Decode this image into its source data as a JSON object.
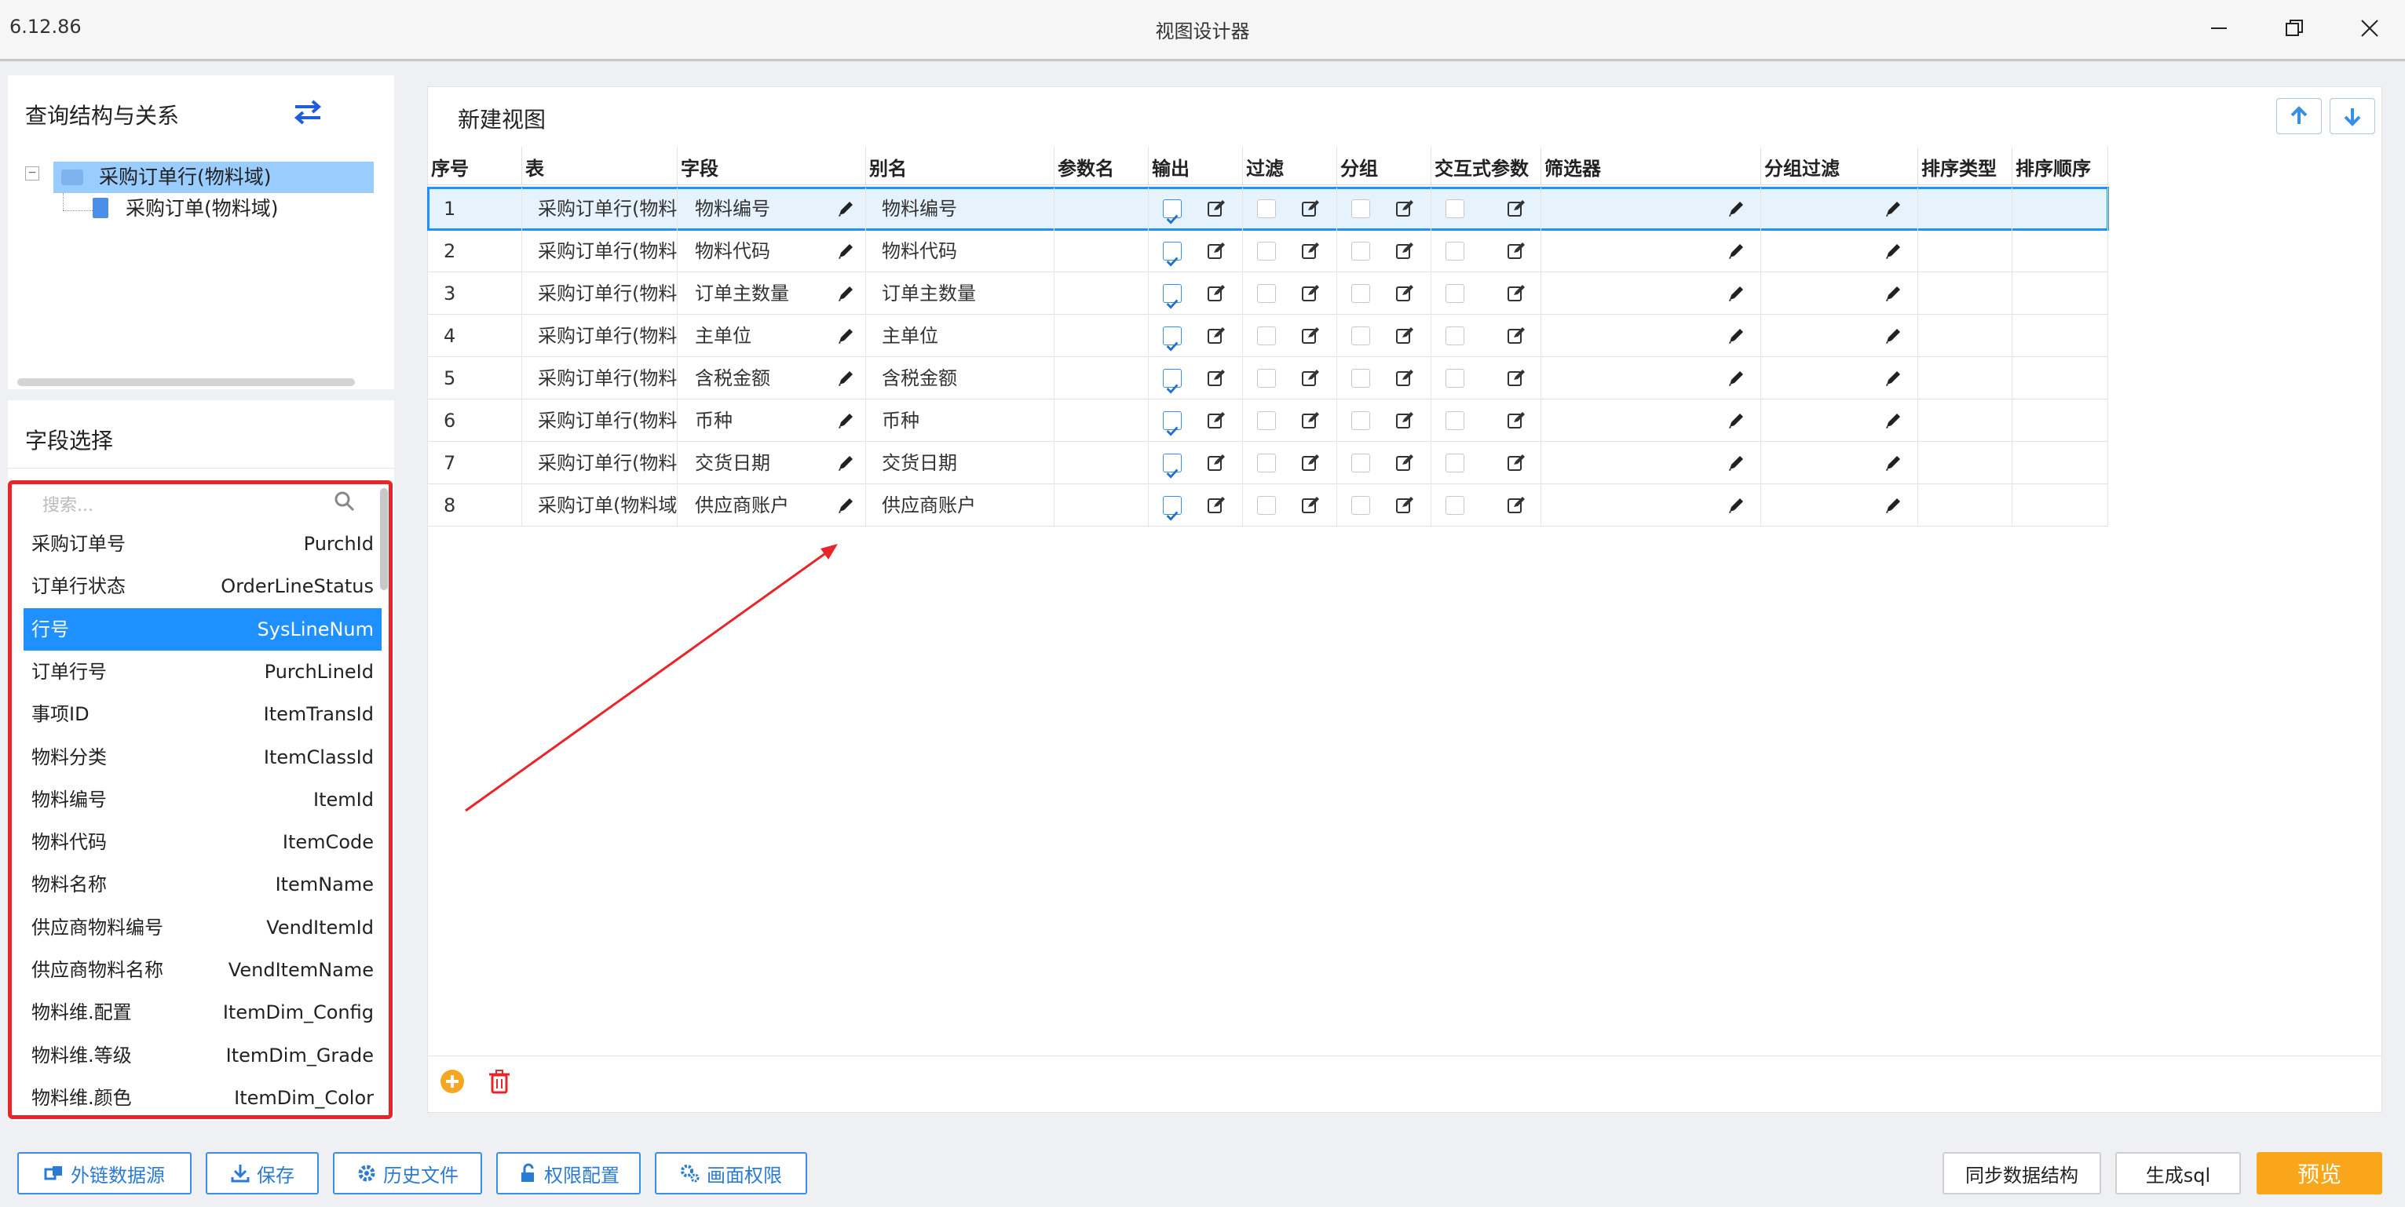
{
  "window": {
    "version": "6.12.86",
    "title": "视图设计器"
  },
  "query_panel": {
    "title": "查询结构与关系",
    "tree": [
      {
        "label": "采购订单行(物料域)",
        "selected": true
      },
      {
        "label": "采购订单(物料域)",
        "selected": false
      }
    ]
  },
  "field_panel": {
    "title": "字段选择",
    "search_placeholder": "搜索...",
    "fields": [
      {
        "cn": "采购订单号",
        "en": "PurchId"
      },
      {
        "cn": "订单行状态",
        "en": "OrderLineStatus"
      },
      {
        "cn": "行号",
        "en": "SysLineNum",
        "selected": true
      },
      {
        "cn": "订单行号",
        "en": "PurchLineId"
      },
      {
        "cn": "事项ID",
        "en": "ItemTransId"
      },
      {
        "cn": "物料分类",
        "en": "ItemClassId"
      },
      {
        "cn": "物料编号",
        "en": "ItemId"
      },
      {
        "cn": "物料代码",
        "en": "ItemCode"
      },
      {
        "cn": "物料名称",
        "en": "ItemName"
      },
      {
        "cn": "供应商物料编号",
        "en": "VendItemId"
      },
      {
        "cn": "供应商物料名称",
        "en": "VendItemName"
      },
      {
        "cn": "物料维.配置",
        "en": "ItemDim_Config"
      },
      {
        "cn": "物料维.等级",
        "en": "ItemDim_Grade"
      },
      {
        "cn": "物料维.颜色",
        "en": "ItemDim_Color"
      }
    ]
  },
  "view_panel": {
    "title": "新建视图",
    "columns": [
      "序号",
      "表",
      "字段",
      "别名",
      "参数名",
      "输出",
      "过滤",
      "分组",
      "交互式参数",
      "筛选器",
      "分组过滤",
      "排序类型",
      "排序顺序"
    ],
    "rows": [
      {
        "no": "1",
        "table": "采购订单行(物料域)",
        "field": "物料编号",
        "alias": "物料编号",
        "output": true
      },
      {
        "no": "2",
        "table": "采购订单行(物料域)",
        "field": "物料代码",
        "alias": "物料代码",
        "output": true
      },
      {
        "no": "3",
        "table": "采购订单行(物料域)",
        "field": "订单主数量",
        "alias": "订单主数量",
        "output": true
      },
      {
        "no": "4",
        "table": "采购订单行(物料域)",
        "field": "主单位",
        "alias": "主单位",
        "output": true
      },
      {
        "no": "5",
        "table": "采购订单行(物料域)",
        "field": "含税金额",
        "alias": "含税金额",
        "output": true
      },
      {
        "no": "6",
        "table": "采购订单行(物料域)",
        "field": "币种",
        "alias": "币种",
        "output": true
      },
      {
        "no": "7",
        "table": "采购订单行(物料域)",
        "field": "交货日期",
        "alias": "交货日期",
        "output": true
      },
      {
        "no": "8",
        "table": "采购订单(物料域)",
        "field": "供应商账户",
        "alias": "供应商账户",
        "output": true
      }
    ]
  },
  "footer": {
    "left_buttons": [
      "外链数据源",
      "保存",
      "历史文件",
      "权限配置",
      "画面权限"
    ],
    "sync": "同步数据结构",
    "gensql": "生成sql",
    "preview": "预览"
  },
  "colors": {
    "accent": "#1e90ff",
    "annotation_red": "#e8262a",
    "preview": "#faa61a"
  }
}
